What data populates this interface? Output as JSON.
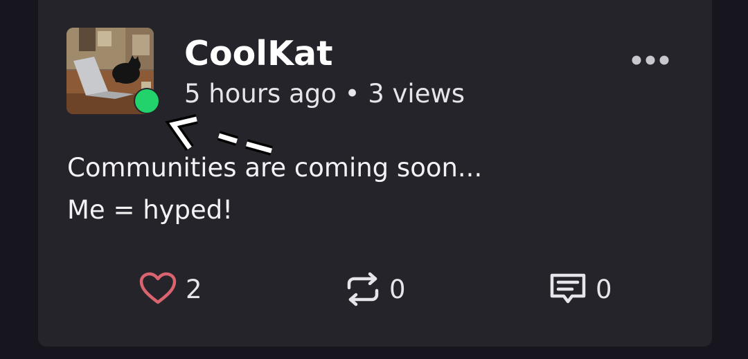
{
  "post": {
    "username": "CoolKat",
    "meta": "5 hours ago • 3 views",
    "status": "online",
    "status_color": "#22d36b",
    "lines": [
      "Communities are coming soon...",
      "Me = hyped!"
    ]
  },
  "actions": {
    "likes": "2",
    "reposts": "0",
    "comments": "0",
    "like_color": "#d9646f"
  },
  "icons": {
    "more": "more-horizontal-icon",
    "like": "heart-icon",
    "repost": "repost-icon",
    "comment": "comment-icon"
  }
}
